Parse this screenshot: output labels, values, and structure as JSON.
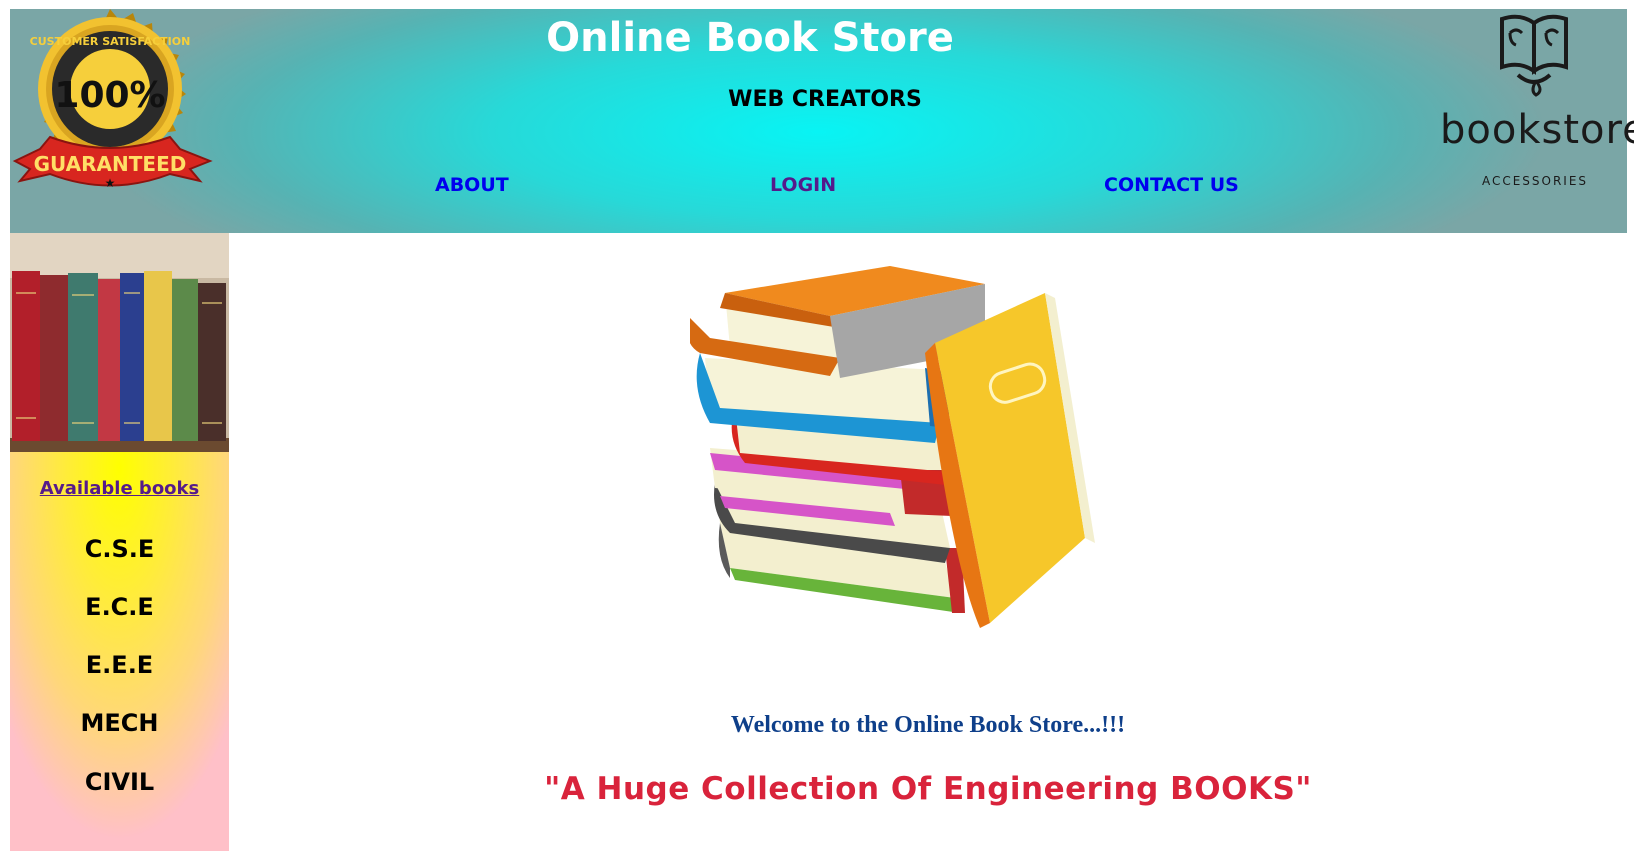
{
  "header": {
    "title": "Online Book Store",
    "subtitle": "WEB CREATORS",
    "nav": {
      "about": "ABOUT",
      "login": "LOGIN",
      "contact": "CONTACT US"
    },
    "badge": {
      "top_text": "CUSTOMER SATISFACTION",
      "center_text": "100%",
      "ribbon_text": "GUARANTEED"
    },
    "brand": {
      "name": "bookstore",
      "tagline": "ACCESSORIES"
    }
  },
  "sidebar": {
    "heading": "Available books",
    "categories": [
      "C.S.E",
      "E.C.E",
      "E.E.E",
      "MECH",
      "CIVIL"
    ]
  },
  "main": {
    "welcome": "Welcome to the Online Book Store...!!!",
    "tagline": "\"A Huge Collection Of Engineering BOOKS\""
  },
  "colors": {
    "header_center": "#08f4f4",
    "header_edge": "#7aa6a6",
    "link": "#0000ee",
    "visited_link": "#551a8b",
    "welcome": "#0e3f8a",
    "tagline": "#d9233b",
    "sidebar_center": "#ffff00",
    "sidebar_edge": "#ffc0c8"
  }
}
